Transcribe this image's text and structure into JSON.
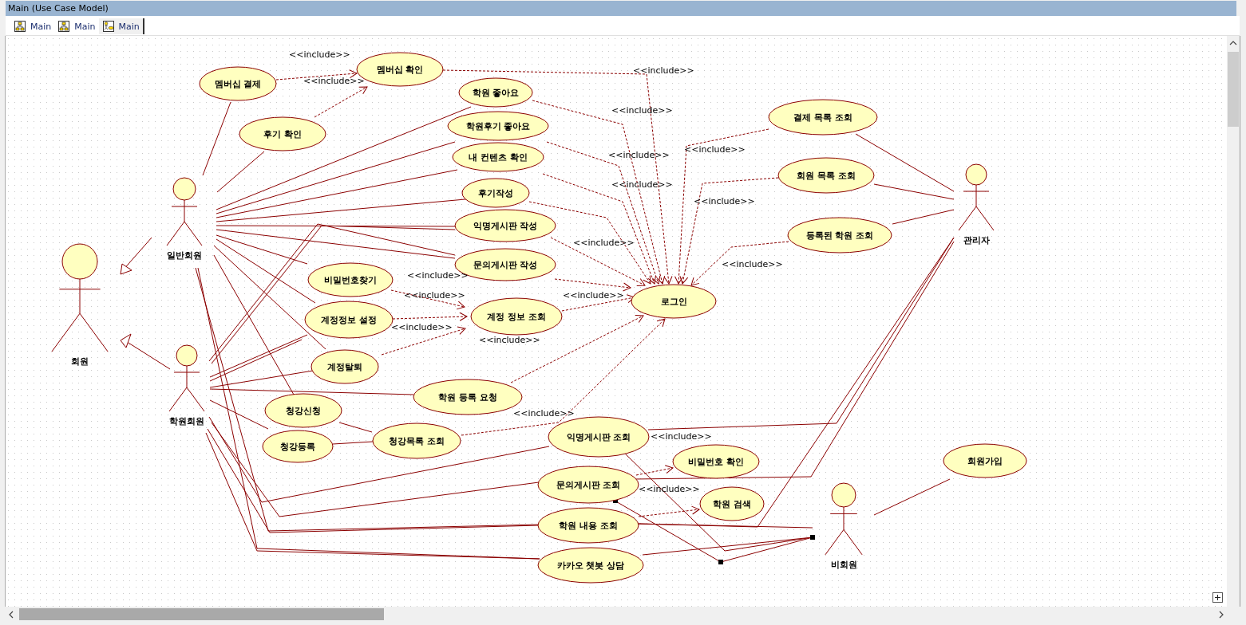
{
  "window": {
    "title": "Main (Use Case Model)"
  },
  "tabs": [
    {
      "label": "Main",
      "kind": "diagram",
      "selected": false
    },
    {
      "label": "Main",
      "kind": "diagram",
      "selected": false
    },
    {
      "label": "Main",
      "kind": "usecase",
      "selected": true
    }
  ],
  "diagram": {
    "actors": [
      {
        "label": "회원"
      },
      {
        "label": "일반회원"
      },
      {
        "label": "학원회원"
      },
      {
        "label": "관리자"
      },
      {
        "label": "비회원"
      }
    ],
    "use_cases": [
      {
        "label": "멤버십 결제"
      },
      {
        "label": "멤버십 확인"
      },
      {
        "label": "후기 확인"
      },
      {
        "label": "학원 좋아요"
      },
      {
        "label": "학원후기 좋아요"
      },
      {
        "label": "내 컨텐츠 확인"
      },
      {
        "label": "후기작성"
      },
      {
        "label": "익명게시판 작성"
      },
      {
        "label": "문의게시판 작성"
      },
      {
        "label": "비밀번호찾기"
      },
      {
        "label": "계정정보 설정"
      },
      {
        "label": "계정 정보 조회"
      },
      {
        "label": "로그인"
      },
      {
        "label": "계정탈퇴"
      },
      {
        "label": "학원 등록 요청"
      },
      {
        "label": "청강신청"
      },
      {
        "label": "청강등록"
      },
      {
        "label": "청강목록 조회"
      },
      {
        "label": "익명게시판 조회"
      },
      {
        "label": "비밀번호 확인"
      },
      {
        "label": "문의게시판 조회"
      },
      {
        "label": "학원 검색"
      },
      {
        "label": "학원 내용 조회"
      },
      {
        "label": "카카오 챗봇 상담"
      },
      {
        "label": "결제 목록 조회"
      },
      {
        "label": "회원 목록 조회"
      },
      {
        "label": "등록된 학원 조회"
      },
      {
        "label": "회원가입"
      }
    ],
    "include_labels": [
      "<<include>>",
      "<<include>>",
      "<<include>>",
      "<<include>>",
      "<<include>>",
      "<<include>>",
      "<<include>>",
      "<<include>>",
      "<<include>>",
      "<<include>>",
      "<<include>>",
      "<<include>>",
      "<<include>>",
      "<<include>>",
      "<<include>>",
      "<<include>>",
      "<<include>>",
      "<<include>>"
    ]
  }
}
